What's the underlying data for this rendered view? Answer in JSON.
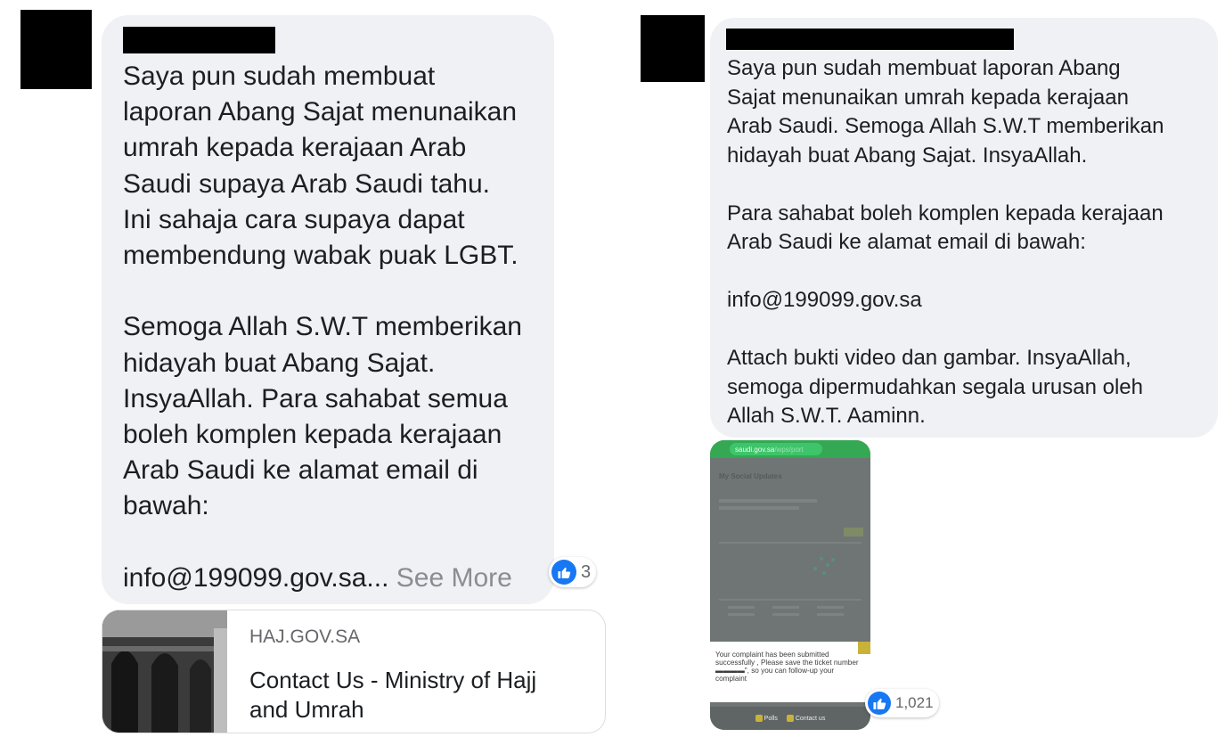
{
  "left_comment": {
    "text": "Saya pun sudah membuat\nlaporan Abang Sajat menunaikan\numrah kepada kerajaan Arab\nSaudi supaya Arab Saudi tahu.\nIni sahaja cara supaya dapat\nmembendung wabak puak LGBT.\n\nSemoga Allah S.W.T memberikan\nhidayah buat Abang Sajat.\nInsyaAllah. Para sahabat semua\nboleh komplen kepada kerajaan\nArab Saudi ke alamat email di\nbawah:\n\ninfo@199099.gov.sa...",
    "see_more": " See More",
    "reaction_count": "3",
    "link_preview": {
      "domain": "HAJ.GOV.SA",
      "title": "Contact Us - Ministry of Hajj and Umrah"
    }
  },
  "right_comment": {
    "text": "Saya pun sudah membuat laporan Abang\nSajat menunaikan umrah kepada kerajaan\nArab Saudi. Semoga Allah S.W.T memberikan\nhidayah buat Abang Sajat. InsyaAllah.\n\nPara sahabat boleh komplen kepada kerajaan\nArab Saudi ke alamat email di bawah:\n\ninfo@199099.gov.sa\n\nAttach bukti video dan gambar. InsyaAllah,\nsemoga dipermudahkan segala urusan oleh\nAllah S.W.T. Aaminn.",
    "reaction_count": "1,021",
    "attachment": {
      "url": "saudi.gov.sa",
      "url_rest": "/wps/port",
      "header": "My Social Updates",
      "popup": "Your complaint has been submitted successfully , Please save the ticket number ▬▬▬▬\", so you can follow-up your complaint",
      "bottom_left": "Polls",
      "bottom_right": "Contact us"
    }
  },
  "colors": {
    "bubble": "#eff1f4",
    "like_blue": "#1877f2",
    "phone_green": "#34a853"
  }
}
